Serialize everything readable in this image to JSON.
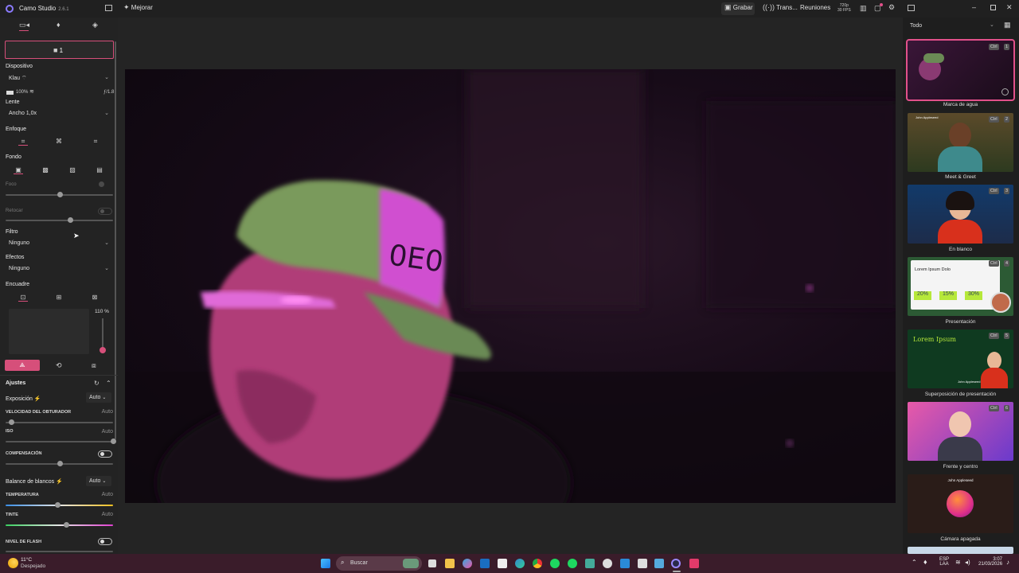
{
  "titlebar": {
    "app_name": "Camo Studio",
    "version": "2.6.1",
    "mejorar_label": "Mejorar",
    "grabar_label": "Grabar",
    "trans_label": "Trans...",
    "reuniones_label": "Reuniones",
    "res_label": "720p",
    "fps_label": "30 FPS"
  },
  "left": {
    "device_count": "1",
    "dispositivo_label": "Dispositivo",
    "dispositivo_value": "Klau ⌔",
    "battery_label": "100%",
    "aperture_label": "ƒ/1.8",
    "lente_label": "Lente",
    "lente_value": "Ancho 1,0x",
    "enfoque_label": "Enfoque",
    "fondo_label": "Fondo",
    "foco_label": "Foco",
    "retocar_label": "Retocar",
    "filtro_label": "Filtro",
    "filtro_value": "Ninguno",
    "efectos_label": "Efectos",
    "efectos_value": "Ninguno",
    "encuadre_label": "Encuadre",
    "zoom_label": "110 %",
    "ajustes_label": "Ajustes",
    "exposicion_label": "Exposición",
    "exposicion_value": "Auto",
    "obturador_label": "VELOCIDAD DEL OBTURADOR",
    "obturador_value": "Auto",
    "iso_label": "ISO",
    "iso_value": "Auto",
    "compensacion_label": "COMPENSACIÓN",
    "balance_label": "Balance de blancos",
    "balance_value": "Auto",
    "temperatura_label": "TEMPERATURA",
    "temperatura_value": "Auto",
    "tinte_label": "TINTE",
    "tinte_value": "Auto",
    "flash_label": "NIVEL DE FLASH",
    "sliders": {
      "foco": 0.5,
      "retocar": 0.6,
      "obturador": 0.05,
      "iso": 1.0,
      "compensacion": 0.5,
      "temperatura": 0.48,
      "tinte": 0.56,
      "zoom": 0.1
    }
  },
  "right": {
    "filter_value": "Todo",
    "scenes": [
      {
        "label": "Marca de agua",
        "shortcut": "Ctrl",
        "num": "1"
      },
      {
        "label": "Meet & Greet",
        "shortcut": "Ctrl",
        "num": "2",
        "name": "John Appleseed"
      },
      {
        "label": "En blanco",
        "shortcut": "Ctrl",
        "num": "3"
      },
      {
        "label": "Presentación",
        "shortcut": "Ctrl",
        "num": "4",
        "slide_title": "Lorem Ipsum Dolo",
        "stats": [
          "20%",
          "15%",
          "30%"
        ]
      },
      {
        "label": "Superposición de presentación",
        "shortcut": "Ctrl",
        "num": "5",
        "slide_title": "Lorem Ipsum",
        "name": "John Appleseed"
      },
      {
        "label": "Frente y centro",
        "shortcut": "Ctrl",
        "num": "6"
      },
      {
        "label": "Cámara apagada",
        "name": "John Appleseed"
      }
    ]
  },
  "video": {
    "cap_text": "0E0"
  },
  "taskbar": {
    "temp": "11°C",
    "weather": "Despejado",
    "search_placeholder": "Buscar",
    "lang1": "ESP",
    "lang2": "LAA",
    "time": "3:07",
    "date": "21/03/2026"
  }
}
